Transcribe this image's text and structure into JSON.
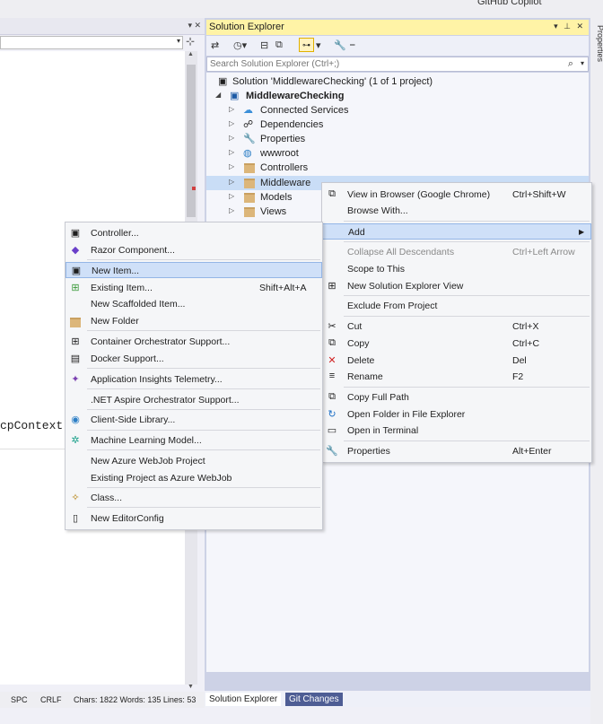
{
  "top": {
    "copilot_label": "GitHub Copilot"
  },
  "editor": {
    "code_snippet": "cpContext.",
    "status": {
      "encoding": "SPC",
      "line_ending": "CRLF",
      "stats": "Chars: 1822  Words: 135  Lines: 53"
    }
  },
  "solution_explorer": {
    "title": "Solution Explorer",
    "search_placeholder": "Search Solution Explorer (Ctrl+;)",
    "tree": [
      {
        "label": "Solution 'MiddlewareChecking' (1 of 1 project)",
        "icon": "solution-icon"
      },
      {
        "label": "MiddlewareChecking",
        "icon": "project-icon",
        "bold": true
      },
      {
        "label": "Connected Services",
        "icon": "connected-services-icon"
      },
      {
        "label": "Dependencies",
        "icon": "dependencies-icon"
      },
      {
        "label": "Properties",
        "icon": "properties-icon"
      },
      {
        "label": "wwwroot",
        "icon": "globe-icon"
      },
      {
        "label": "Controllers",
        "icon": "folder-icon"
      },
      {
        "label": "Middleware",
        "icon": "folder-icon",
        "selected": true
      },
      {
        "label": "Models",
        "icon": "folder-icon"
      },
      {
        "label": "Views",
        "icon": "folder-icon"
      }
    ],
    "tabs": [
      {
        "label": "Solution Explorer"
      },
      {
        "label": "Git Changes"
      }
    ]
  },
  "context_menu": {
    "items": [
      {
        "label": "View in Browser (Google Chrome)",
        "shortcut": "Ctrl+Shift+W",
        "icon": "browser-icon"
      },
      {
        "label": "Browse With...",
        "shortcut": ""
      },
      {
        "label": "Add",
        "shortcut": "",
        "submenu": true
      },
      {
        "label": "Collapse All Descendants",
        "shortcut": "Ctrl+Left Arrow",
        "disabled": true
      },
      {
        "label": "Scope to This",
        "shortcut": ""
      },
      {
        "label": "New Solution Explorer View",
        "shortcut": "",
        "icon": "new-view-icon"
      },
      {
        "label": "Exclude From Project",
        "shortcut": ""
      },
      {
        "label": "Cut",
        "shortcut": "Ctrl+X",
        "icon": "cut-icon"
      },
      {
        "label": "Copy",
        "shortcut": "Ctrl+C",
        "icon": "copy-icon"
      },
      {
        "label": "Delete",
        "shortcut": "Del",
        "icon": "delete-icon"
      },
      {
        "label": "Rename",
        "shortcut": "F2",
        "icon": "rename-icon"
      },
      {
        "label": "Copy Full Path",
        "shortcut": "",
        "icon": "copy-path-icon"
      },
      {
        "label": "Open Folder in File Explorer",
        "shortcut": "",
        "icon": "open-folder-icon"
      },
      {
        "label": "Open in Terminal",
        "shortcut": "",
        "icon": "terminal-icon"
      },
      {
        "label": "Properties",
        "shortcut": "Alt+Enter",
        "icon": "wrench-icon"
      }
    ]
  },
  "add_submenu": {
    "items": [
      {
        "label": "Controller...",
        "icon": "controller-icon"
      },
      {
        "label": "Razor Component...",
        "icon": "razor-icon"
      },
      {
        "label": "New Item...",
        "icon": "new-item-icon",
        "shortcut": ""
      },
      {
        "label": "Existing Item...",
        "icon": "existing-item-icon",
        "shortcut": "Shift+Alt+A"
      },
      {
        "label": "New Scaffolded Item...",
        "icon": ""
      },
      {
        "label": "New Folder",
        "icon": "new-folder-icon"
      },
      {
        "label": "Container Orchestrator Support...",
        "icon": "container-icon"
      },
      {
        "label": "Docker Support...",
        "icon": "docker-icon"
      },
      {
        "label": "Application Insights Telemetry...",
        "icon": "insights-icon"
      },
      {
        "label": ".NET Aspire Orchestrator Support...",
        "icon": ""
      },
      {
        "label": "Client-Side Library...",
        "icon": "library-icon"
      },
      {
        "label": "Machine Learning Model...",
        "icon": "ml-icon"
      },
      {
        "label": "New Azure WebJob Project",
        "icon": ""
      },
      {
        "label": "Existing Project as Azure WebJob",
        "icon": ""
      },
      {
        "label": "Class...",
        "icon": "class-icon"
      },
      {
        "label": "New EditorConfig",
        "icon": "editorconfig-icon"
      }
    ]
  },
  "colors": {
    "accent": "#007acc",
    "selection": "#cfe0f8",
    "title_yellow": "#fff3a6",
    "tab_blue": "#4e5d94"
  }
}
